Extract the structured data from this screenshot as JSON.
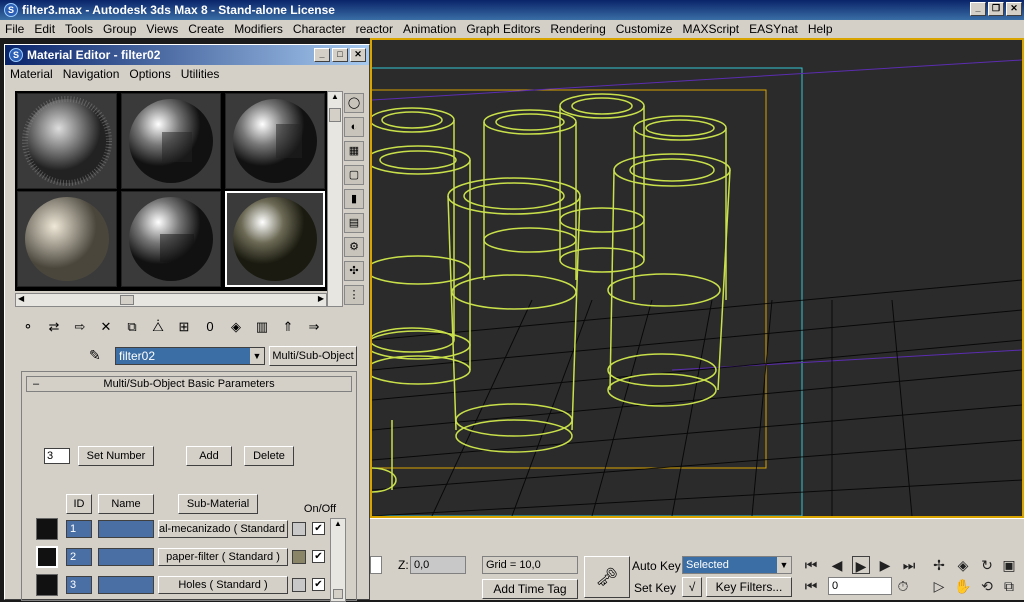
{
  "window": {
    "title": "filter3.max - Autodesk 3ds Max 8 - Stand-alone License",
    "menu": [
      "File",
      "Edit",
      "Tools",
      "Group",
      "Views",
      "Create",
      "Modifiers",
      "Character",
      "reactor",
      "Animation",
      "Graph Editors",
      "Rendering",
      "Customize",
      "MAXScript",
      "EASYnat",
      "Help"
    ]
  },
  "material_editor": {
    "title": "Material Editor - filter02",
    "menu": [
      "Material",
      "Navigation",
      "Options",
      "Utilities"
    ],
    "material_name": "filter02",
    "type_button": "Multi/Sub-Object",
    "rollout_title": "Multi/Sub-Object Basic Parameters",
    "rollout_toggle": "–",
    "set_number_value": "3",
    "set_number_label": "Set Number",
    "add_label": "Add",
    "delete_label": "Delete",
    "headers": {
      "id": "ID",
      "name": "Name",
      "sub_material": "Sub-Material",
      "onoff": "On/Off"
    },
    "rows": [
      {
        "id": "1",
        "sub": "al-mecanizado  ( Standard )",
        "color": "#c8c8c8",
        "check": "✔"
      },
      {
        "id": "2",
        "sub": "paper-filter  ( Standard )",
        "color": "#8a8566",
        "check": "✔"
      },
      {
        "id": "3",
        "sub": "Holes  ( Standard )",
        "color": "#c8c8c8",
        "check": "✔"
      }
    ]
  },
  "statusbar": {
    "z_label": "Z:",
    "z_value": "0,0",
    "grid": "Grid = 10,0",
    "add_time_tag": "Add Time Tag",
    "auto_key": "Auto Key",
    "set_key": "Set Key",
    "selected": "Selected",
    "key_filters": "Key Filters...",
    "frame": "0"
  },
  "colors": {
    "accent": "#0a246a",
    "wireframe": "#c9e04a",
    "viewport_border": "#d9a400"
  }
}
